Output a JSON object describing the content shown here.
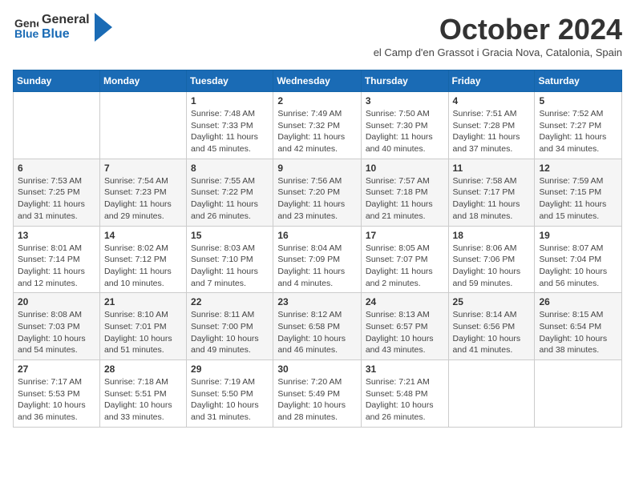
{
  "header": {
    "logo_general": "General",
    "logo_blue": "Blue",
    "month_title": "October 2024",
    "subtitle": "el Camp d'en Grassot i Gracia Nova, Catalonia, Spain"
  },
  "days_of_week": [
    "Sunday",
    "Monday",
    "Tuesday",
    "Wednesday",
    "Thursday",
    "Friday",
    "Saturday"
  ],
  "weeks": [
    [
      {
        "num": "",
        "detail": ""
      },
      {
        "num": "",
        "detail": ""
      },
      {
        "num": "1",
        "detail": "Sunrise: 7:48 AM\nSunset: 7:33 PM\nDaylight: 11 hours and 45 minutes."
      },
      {
        "num": "2",
        "detail": "Sunrise: 7:49 AM\nSunset: 7:32 PM\nDaylight: 11 hours and 42 minutes."
      },
      {
        "num": "3",
        "detail": "Sunrise: 7:50 AM\nSunset: 7:30 PM\nDaylight: 11 hours and 40 minutes."
      },
      {
        "num": "4",
        "detail": "Sunrise: 7:51 AM\nSunset: 7:28 PM\nDaylight: 11 hours and 37 minutes."
      },
      {
        "num": "5",
        "detail": "Sunrise: 7:52 AM\nSunset: 7:27 PM\nDaylight: 11 hours and 34 minutes."
      }
    ],
    [
      {
        "num": "6",
        "detail": "Sunrise: 7:53 AM\nSunset: 7:25 PM\nDaylight: 11 hours and 31 minutes."
      },
      {
        "num": "7",
        "detail": "Sunrise: 7:54 AM\nSunset: 7:23 PM\nDaylight: 11 hours and 29 minutes."
      },
      {
        "num": "8",
        "detail": "Sunrise: 7:55 AM\nSunset: 7:22 PM\nDaylight: 11 hours and 26 minutes."
      },
      {
        "num": "9",
        "detail": "Sunrise: 7:56 AM\nSunset: 7:20 PM\nDaylight: 11 hours and 23 minutes."
      },
      {
        "num": "10",
        "detail": "Sunrise: 7:57 AM\nSunset: 7:18 PM\nDaylight: 11 hours and 21 minutes."
      },
      {
        "num": "11",
        "detail": "Sunrise: 7:58 AM\nSunset: 7:17 PM\nDaylight: 11 hours and 18 minutes."
      },
      {
        "num": "12",
        "detail": "Sunrise: 7:59 AM\nSunset: 7:15 PM\nDaylight: 11 hours and 15 minutes."
      }
    ],
    [
      {
        "num": "13",
        "detail": "Sunrise: 8:01 AM\nSunset: 7:14 PM\nDaylight: 11 hours and 12 minutes."
      },
      {
        "num": "14",
        "detail": "Sunrise: 8:02 AM\nSunset: 7:12 PM\nDaylight: 11 hours and 10 minutes."
      },
      {
        "num": "15",
        "detail": "Sunrise: 8:03 AM\nSunset: 7:10 PM\nDaylight: 11 hours and 7 minutes."
      },
      {
        "num": "16",
        "detail": "Sunrise: 8:04 AM\nSunset: 7:09 PM\nDaylight: 11 hours and 4 minutes."
      },
      {
        "num": "17",
        "detail": "Sunrise: 8:05 AM\nSunset: 7:07 PM\nDaylight: 11 hours and 2 minutes."
      },
      {
        "num": "18",
        "detail": "Sunrise: 8:06 AM\nSunset: 7:06 PM\nDaylight: 10 hours and 59 minutes."
      },
      {
        "num": "19",
        "detail": "Sunrise: 8:07 AM\nSunset: 7:04 PM\nDaylight: 10 hours and 56 minutes."
      }
    ],
    [
      {
        "num": "20",
        "detail": "Sunrise: 8:08 AM\nSunset: 7:03 PM\nDaylight: 10 hours and 54 minutes."
      },
      {
        "num": "21",
        "detail": "Sunrise: 8:10 AM\nSunset: 7:01 PM\nDaylight: 10 hours and 51 minutes."
      },
      {
        "num": "22",
        "detail": "Sunrise: 8:11 AM\nSunset: 7:00 PM\nDaylight: 10 hours and 49 minutes."
      },
      {
        "num": "23",
        "detail": "Sunrise: 8:12 AM\nSunset: 6:58 PM\nDaylight: 10 hours and 46 minutes."
      },
      {
        "num": "24",
        "detail": "Sunrise: 8:13 AM\nSunset: 6:57 PM\nDaylight: 10 hours and 43 minutes."
      },
      {
        "num": "25",
        "detail": "Sunrise: 8:14 AM\nSunset: 6:56 PM\nDaylight: 10 hours and 41 minutes."
      },
      {
        "num": "26",
        "detail": "Sunrise: 8:15 AM\nSunset: 6:54 PM\nDaylight: 10 hours and 38 minutes."
      }
    ],
    [
      {
        "num": "27",
        "detail": "Sunrise: 7:17 AM\nSunset: 5:53 PM\nDaylight: 10 hours and 36 minutes."
      },
      {
        "num": "28",
        "detail": "Sunrise: 7:18 AM\nSunset: 5:51 PM\nDaylight: 10 hours and 33 minutes."
      },
      {
        "num": "29",
        "detail": "Sunrise: 7:19 AM\nSunset: 5:50 PM\nDaylight: 10 hours and 31 minutes."
      },
      {
        "num": "30",
        "detail": "Sunrise: 7:20 AM\nSunset: 5:49 PM\nDaylight: 10 hours and 28 minutes."
      },
      {
        "num": "31",
        "detail": "Sunrise: 7:21 AM\nSunset: 5:48 PM\nDaylight: 10 hours and 26 minutes."
      },
      {
        "num": "",
        "detail": ""
      },
      {
        "num": "",
        "detail": ""
      }
    ]
  ]
}
